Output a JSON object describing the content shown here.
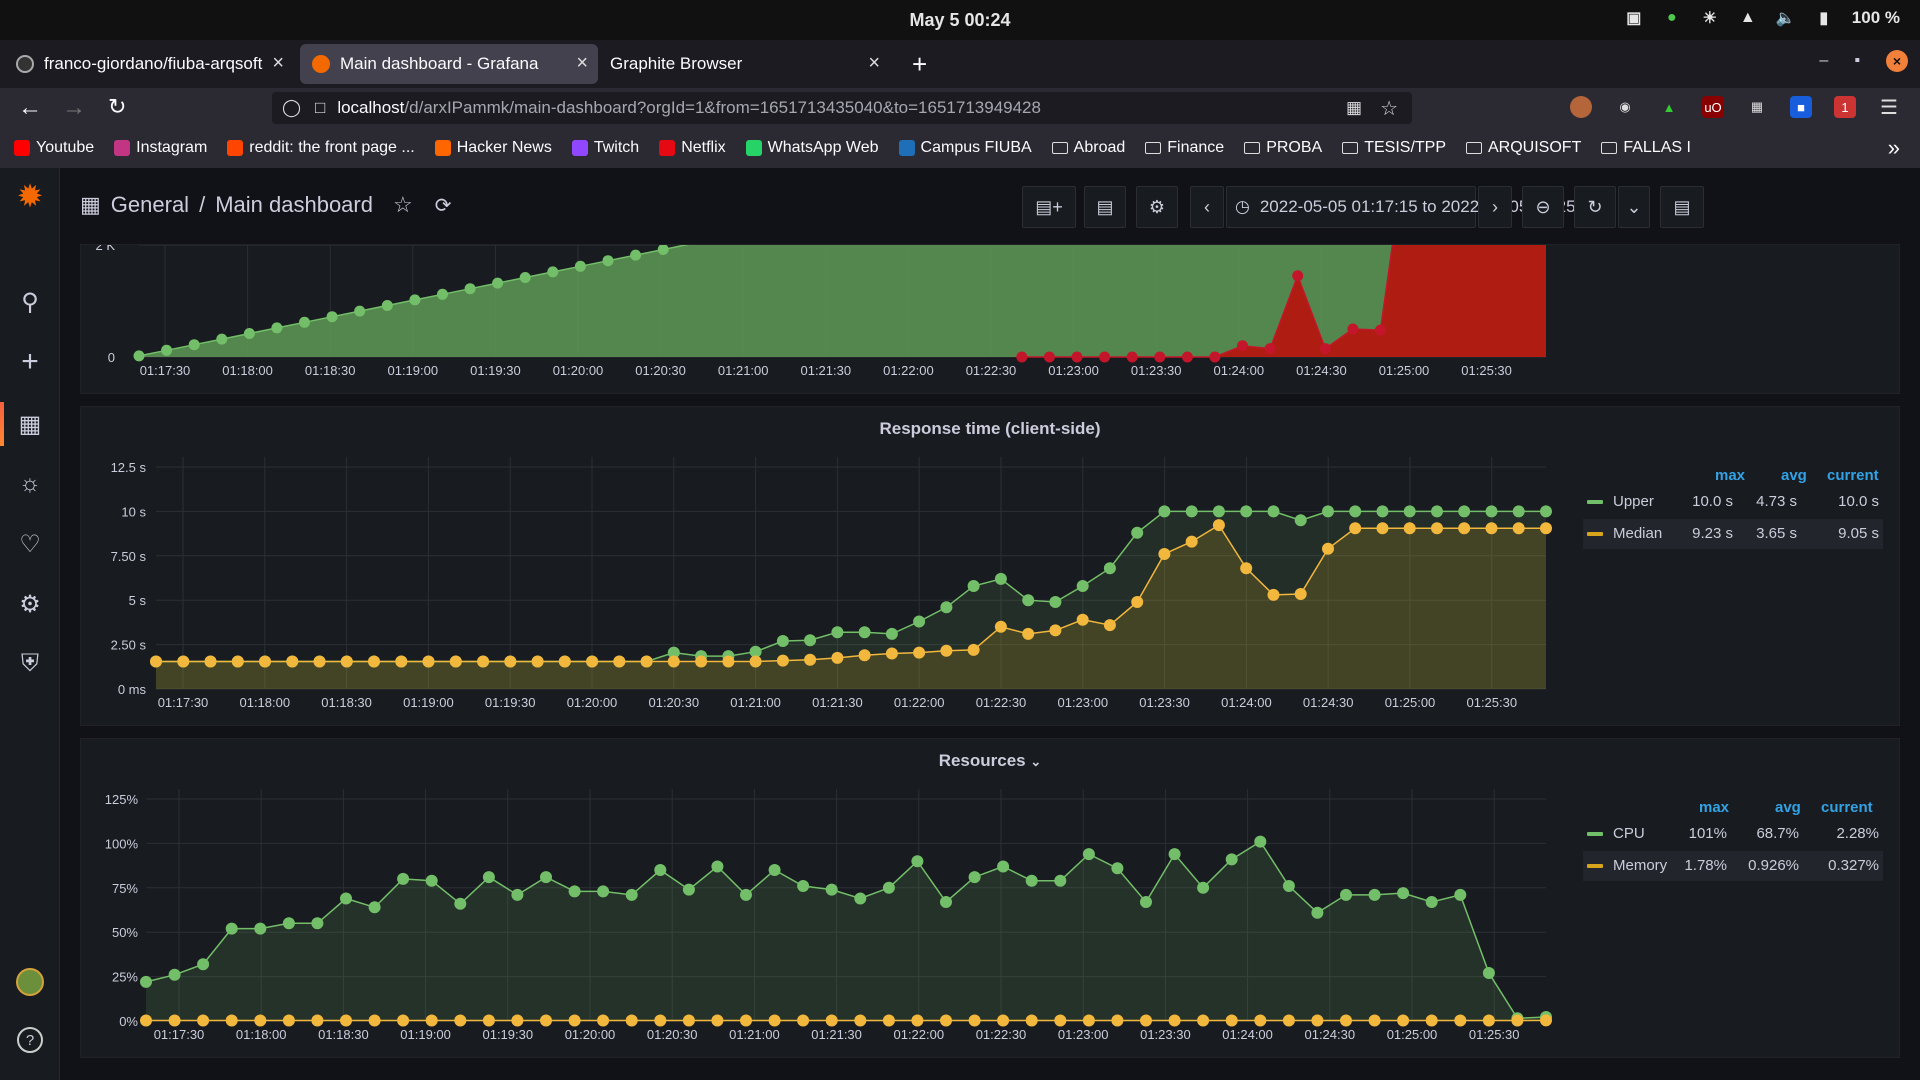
{
  "system": {
    "clock": "May 5  00:24",
    "battery": "100 %"
  },
  "tabs": [
    {
      "title": "franco-giordano/fiuba-arqsoft",
      "active": false
    },
    {
      "title": "Main dashboard - Grafana",
      "active": true
    },
    {
      "title": "Graphite Browser",
      "active": false
    }
  ],
  "url": {
    "host": "localhost",
    "path": "/d/arxIPammk/main-dashboard?orgId=1&from=1651713435040&to=1651713949428"
  },
  "bookmarks": [
    {
      "label": "Youtube",
      "icon": "youtube-icon",
      "color": "#ff0000"
    },
    {
      "label": "Instagram",
      "icon": "instagram-icon",
      "color": "#c13584"
    },
    {
      "label": "reddit: the front page ...",
      "icon": "reddit-icon",
      "color": "#ff4500"
    },
    {
      "label": "Hacker News",
      "icon": "hackernews-icon",
      "color": "#ff6600"
    },
    {
      "label": "Twitch",
      "icon": "twitch-icon",
      "color": "#9146ff"
    },
    {
      "label": "Netflix",
      "icon": "netflix-icon",
      "color": "#e50914"
    },
    {
      "label": "WhatsApp Web",
      "icon": "whatsapp-icon",
      "color": "#25d366"
    },
    {
      "label": "Campus FIUBA",
      "icon": "campus-icon",
      "color": "#1e6fb8"
    },
    {
      "label": "Abroad",
      "icon": "folder-icon"
    },
    {
      "label": "Finance",
      "icon": "folder-icon"
    },
    {
      "label": "PROBA",
      "icon": "folder-icon"
    },
    {
      "label": "TESIS/TPP",
      "icon": "folder-icon"
    },
    {
      "label": "ARQUISOFT",
      "icon": "folder-icon"
    },
    {
      "label": "FALLAS I",
      "icon": "folder-icon"
    }
  ],
  "dashboard": {
    "folder": "General",
    "title": "Main dashboard",
    "time_range": "2022-05-05 01:17:15 to 2022-05-05 01:25:49"
  },
  "colors": {
    "green": "#73bf69",
    "yellow": "#fade2a",
    "red": "#c4162a",
    "accent": "#33a2e5"
  },
  "panels": {
    "top": {
      "y_ticks": [
        "2 K",
        "0"
      ],
      "x_ticks": [
        "01:17:30",
        "01:18:00",
        "01:18:30",
        "01:19:00",
        "01:19:30",
        "01:20:00",
        "01:20:30",
        "01:21:00",
        "01:21:30",
        "01:22:00",
        "01:22:30",
        "01:23:00",
        "01:23:30",
        "01:24:00",
        "01:24:30",
        "01:25:00",
        "01:25:30"
      ]
    },
    "response": {
      "title": "Response time (client-side)",
      "y_ticks": [
        "12.5 s",
        "10 s",
        "7.50 s",
        "5 s",
        "2.50 s",
        "0 ms"
      ],
      "x_ticks": [
        "01:17:30",
        "01:18:00",
        "01:18:30",
        "01:19:00",
        "01:19:30",
        "01:20:00",
        "01:20:30",
        "01:21:00",
        "01:21:30",
        "01:22:00",
        "01:22:30",
        "01:23:00",
        "01:23:30",
        "01:24:00",
        "01:24:30",
        "01:25:00",
        "01:25:30"
      ],
      "legend_headers": [
        "max",
        "avg",
        "current"
      ],
      "legend": [
        {
          "name": "Upper",
          "max": "10.0 s",
          "avg": "4.73 s",
          "current": "10.0 s"
        },
        {
          "name": "Median",
          "max": "9.23 s",
          "avg": "3.65 s",
          "current": "9.05 s"
        }
      ]
    },
    "resources": {
      "title": "Resources",
      "y_ticks": [
        "125%",
        "100%",
        "75%",
        "50%",
        "25%",
        "0%"
      ],
      "x_ticks": [
        "01:17:30",
        "01:18:00",
        "01:18:30",
        "01:19:00",
        "01:19:30",
        "01:20:00",
        "01:20:30",
        "01:21:00",
        "01:21:30",
        "01:22:00",
        "01:22:30",
        "01:23:00",
        "01:23:30",
        "01:24:00",
        "01:24:30",
        "01:25:00",
        "01:25:30"
      ],
      "legend_headers": [
        "max",
        "avg",
        "current"
      ],
      "legend": [
        {
          "name": "CPU",
          "max": "101%",
          "avg": "68.7%",
          "current": "2.28%"
        },
        {
          "name": "Memory",
          "max": "1.78%",
          "avg": "0.926%",
          "current": "0.327%"
        }
      ]
    }
  },
  "chart_data": [
    {
      "type": "area",
      "title": "",
      "y_unit": "requests",
      "ylim": [
        0,
        4000
      ],
      "x_start": "01:17:15",
      "x_step_seconds": 10,
      "series": [
        {
          "values": [
            20,
            120,
            220,
            320,
            420,
            520,
            620,
            720,
            820,
            920,
            1020,
            1120,
            1220,
            1320,
            1420,
            1520,
            1620,
            1720,
            1820,
            1920,
            2020,
            2120,
            2220,
            2320,
            2420,
            2520,
            2620,
            2720,
            2820,
            2920,
            3020,
            3120,
            3220,
            3320,
            3420,
            3520,
            3620,
            3720,
            3820,
            3920,
            4000,
            4000,
            4000,
            4000,
            4000,
            4000,
            4000,
            4000,
            4000,
            4000,
            4000,
            4000
          ]
        },
        {
          "values": [
            null,
            null,
            null,
            null,
            null,
            null,
            null,
            null,
            null,
            null,
            null,
            null,
            null,
            null,
            null,
            null,
            null,
            null,
            null,
            null,
            null,
            null,
            null,
            null,
            null,
            null,
            null,
            null,
            null,
            null,
            null,
            null,
            0,
            0,
            0,
            0,
            0,
            0,
            0,
            0,
            200,
            150,
            1450,
            150,
            500,
            480,
            4000,
            4000,
            4000,
            4000,
            4000,
            4000
          ]
        }
      ],
      "grid": true
    },
    {
      "type": "line",
      "title": "Response time (client-side)",
      "ylim": [
        0,
        12.5
      ],
      "x_start": "01:17:15",
      "x_step_seconds": 10,
      "series": [
        {
          "name": "Upper",
          "values": [
            1.55,
            1.55,
            1.55,
            1.55,
            1.55,
            1.55,
            1.55,
            1.55,
            1.55,
            1.55,
            1.55,
            1.55,
            1.55,
            1.55,
            1.55,
            1.55,
            1.55,
            1.55,
            1.55,
            2.05,
            1.85,
            1.85,
            2.1,
            2.7,
            2.75,
            3.2,
            3.2,
            3.1,
            3.8,
            4.6,
            5.8,
            6.2,
            5.0,
            4.9,
            5.8,
            6.8,
            8.8,
            10.0,
            10.0,
            10.0,
            10.0,
            10.0,
            9.5,
            10.0,
            10.0,
            10.0,
            10.0,
            10.0,
            10.0,
            10.0,
            10.0,
            10.0
          ]
        },
        {
          "name": "Median",
          "values": [
            1.55,
            1.55,
            1.55,
            1.55,
            1.55,
            1.55,
            1.55,
            1.55,
            1.55,
            1.55,
            1.55,
            1.55,
            1.55,
            1.55,
            1.55,
            1.55,
            1.55,
            1.55,
            1.55,
            1.55,
            1.55,
            1.55,
            1.55,
            1.6,
            1.65,
            1.75,
            1.9,
            2.0,
            2.05,
            2.15,
            2.2,
            3.5,
            3.1,
            3.3,
            3.9,
            3.6,
            4.9,
            7.6,
            8.3,
            9.23,
            6.8,
            5.3,
            5.35,
            7.9,
            9.05,
            9.05,
            9.05,
            9.05,
            9.05,
            9.05,
            9.05,
            9.05
          ]
        }
      ],
      "legend": "right",
      "grid": true
    },
    {
      "type": "line",
      "title": "Resources",
      "ylim": [
        0,
        125
      ],
      "x_start": "01:17:15",
      "x_step_seconds": 10,
      "series": [
        {
          "name": "CPU",
          "values": [
            22,
            26,
            32,
            52,
            52,
            55,
            55,
            69,
            64,
            80,
            79,
            66,
            81,
            71,
            81,
            73,
            73,
            71,
            85,
            74,
            87,
            71,
            85,
            76,
            74,
            69,
            75,
            90,
            67,
            81,
            87,
            79,
            79,
            94,
            86,
            67,
            94,
            75,
            91,
            101,
            76,
            61,
            71,
            71,
            72,
            67,
            71,
            27,
            1.5,
            2.28
          ]
        },
        {
          "name": "Memory",
          "values": [
            0.3,
            0.3,
            0.3,
            0.3,
            0.3,
            0.3,
            0.3,
            0.3,
            0.3,
            0.3,
            0.3,
            0.3,
            0.3,
            0.3,
            0.3,
            0.3,
            0.3,
            0.3,
            0.3,
            0.3,
            0.3,
            0.3,
            0.3,
            0.3,
            0.3,
            0.3,
            0.3,
            0.3,
            0.3,
            0.3,
            0.3,
            0.3,
            0.3,
            0.3,
            0.3,
            0.3,
            0.3,
            0.3,
            0.3,
            0.3,
            0.3,
            0.3,
            0.3,
            0.3,
            0.3,
            0.3,
            0.3,
            0.3,
            0.3,
            0.327
          ]
        }
      ],
      "legend": "right",
      "grid": true
    }
  ]
}
